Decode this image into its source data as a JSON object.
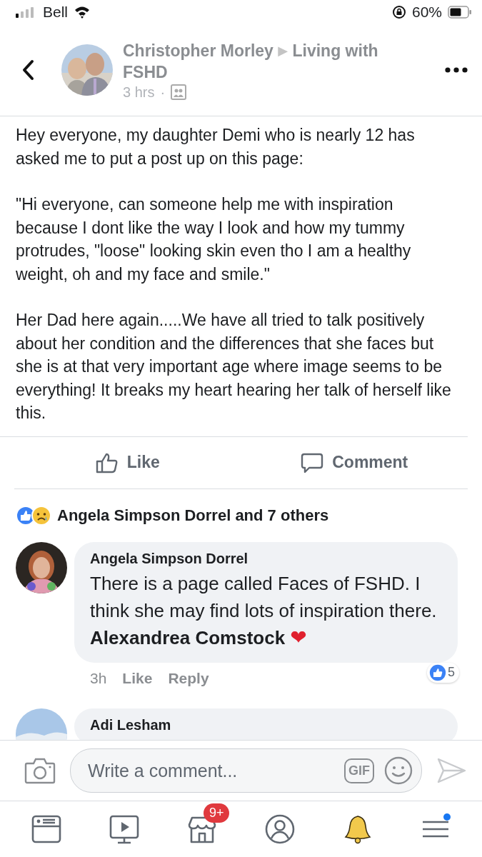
{
  "status_bar": {
    "carrier": "Bell",
    "battery": "60%"
  },
  "post": {
    "author": "Christopher Morley",
    "arrow": "▶",
    "group": "Living with FSHD",
    "time": "3 hrs",
    "separator": "·",
    "paragraphs": [
      "Hey everyone, my daughter Demi who is nearly 12 has asked me to put a post up on this page:",
      "\"Hi everyone, can someone help me with inspiration because I dont like the way I look and how my tummy protrudes, \"loose\" looking skin even tho I am a healthy weight, oh and my face and smile.\"",
      "Her Dad here again.....We have all tried to talk positively about her condition and the differences that she faces but she is at that very important age where image seems to be everything! It breaks my heart hearing her talk of herself like this."
    ]
  },
  "actions": [
    "Like",
    "Comment"
  ],
  "reactions": {
    "summary": "Angela Simpson Dorrel and 7 others"
  },
  "comments": [
    {
      "author": "Angela Simpson Dorrel",
      "text": "There is a page called Faces of FSHD. I think she may find lots of inspiration there. **Alexandrea Comstock**",
      "emoji": "❤",
      "time": "3h",
      "actions": [
        "Like",
        "Reply"
      ],
      "reaction_count": "5"
    },
    {
      "author": "Adi Lesham"
    }
  ],
  "composer": {
    "placeholder": "Write a comment...",
    "gif": "GIF"
  },
  "tabs": [
    {
      "kind": "feed"
    },
    {
      "kind": "video"
    },
    {
      "kind": "marketplace",
      "badge": "9+"
    },
    {
      "kind": "profile"
    },
    {
      "kind": "notifications"
    },
    {
      "kind": "menu"
    }
  ]
}
